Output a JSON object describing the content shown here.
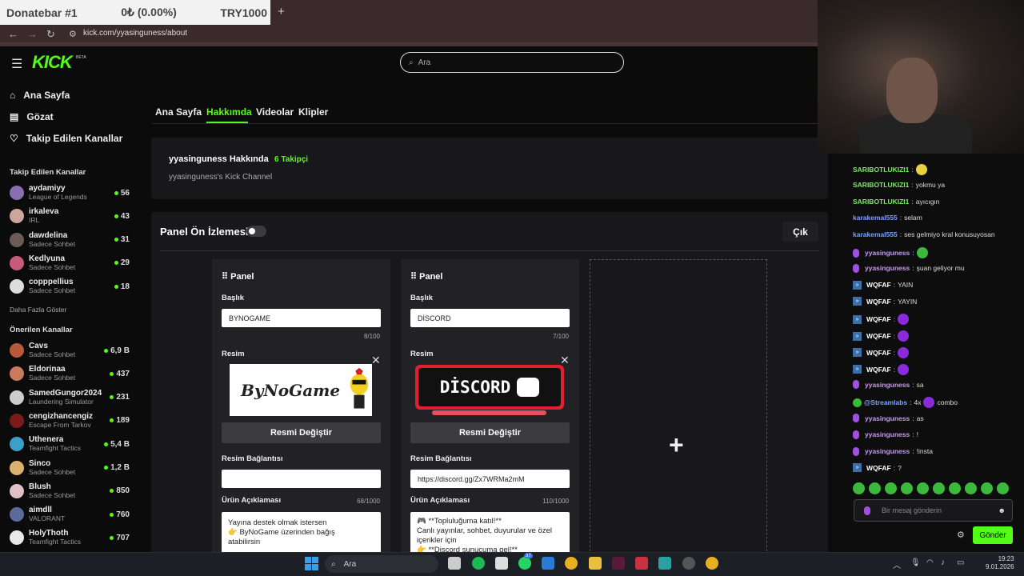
{
  "overlay": {
    "title": "Donatebar #1",
    "amount": "0₺ (0.00%)",
    "goal": "TRY1000"
  },
  "browser": {
    "new_tab": "+",
    "url": "kick.com/yyasinguness/about"
  },
  "header": {
    "logo": "KICK",
    "beta": "BETA",
    "search_placeholder": "Ara"
  },
  "sidebar": {
    "nav": [
      {
        "label": "Ana Sayfa",
        "icon": "home-icon"
      },
      {
        "label": "Gözat",
        "icon": "browse-icon"
      },
      {
        "label": "Takip Edilen Kanallar",
        "icon": "heart-icon"
      }
    ],
    "followed_title": "Takip Edilen Kanallar",
    "followed": [
      {
        "name": "aydamiyy",
        "game": "League of Legends",
        "viewers": "56",
        "color": "#8a6fb0"
      },
      {
        "name": "irkaleva",
        "game": "IRL",
        "viewers": "43",
        "color": "#c9a89a"
      },
      {
        "name": "dawdelina",
        "game": "Sadece Sohbet",
        "viewers": "31",
        "color": "#6b5a55"
      },
      {
        "name": "Kedlyuna",
        "game": "Sadece Sohbet",
        "viewers": "29",
        "color": "#c85a7a"
      },
      {
        "name": "copppellius",
        "game": "Sadece Sohbet",
        "viewers": "18",
        "color": "#dddddd"
      }
    ],
    "show_more": "Daha Fazla Göster",
    "recommended_title": "Önerilen Kanallar",
    "recommended": [
      {
        "name": "Cavs",
        "game": "Sadece Sohbet",
        "viewers": "6,9 B",
        "color": "#b85a3a"
      },
      {
        "name": "Eldorinaa",
        "game": "Sadece Sohbet",
        "viewers": "437",
        "color": "#c97a5a"
      },
      {
        "name": "SamedGungor2024",
        "game": "Laundering Simulator",
        "viewers": "231",
        "color": "#cccccc"
      },
      {
        "name": "cengizhancengiz",
        "game": "Escape From Tarkov",
        "viewers": "189",
        "color": "#7a1a1a"
      },
      {
        "name": "Uthenera",
        "game": "Teamfight Tactics",
        "viewers": "5,4 B",
        "color": "#3aa0c8"
      },
      {
        "name": "Sinco",
        "game": "Sadece Sohbet",
        "viewers": "1,2 B",
        "color": "#d8b070"
      },
      {
        "name": "Blush",
        "game": "Sadece Sohbet",
        "viewers": "850",
        "color": "#e0c0c8"
      },
      {
        "name": "aimdll",
        "game": "VALORANT",
        "viewers": "760",
        "color": "#5a6a9a"
      },
      {
        "name": "HolyThoth",
        "game": "Teamfight Tactics",
        "viewers": "707",
        "color": "#e8e8e8"
      }
    ]
  },
  "tabs": [
    "Ana Sayfa",
    "Hakkımda",
    "Videolar",
    "Klipler"
  ],
  "about": {
    "title": "yyasinguness Hakkında",
    "followers": "6 Takipçi",
    "description": "yyasinguness's Kick Channel"
  },
  "preview": {
    "title": "Panel Ön İzlemesi",
    "exit": "Çık"
  },
  "panels": [
    {
      "header": "Panel",
      "title_label": "Başlık",
      "title_value": "BYNOGAME",
      "title_count": "8/100",
      "image_label": "Resim",
      "image_text": "ByNoGame",
      "change_image": "Resmi Değiştir",
      "link_label": "Resim Bağlantısı",
      "link_value": "",
      "desc_label": "Ürün Açıklaması",
      "desc_count": "68/1000",
      "desc_value": "Yayına destek olmak istersen\n👉 ByNoGame üzerinden bağış\natabilirsin"
    },
    {
      "header": "Panel",
      "title_label": "Başlık",
      "title_value": "DİSCORD",
      "title_count": "7/100",
      "image_label": "Resim",
      "image_text": "DİSCORD",
      "change_image": "Resmi Değiştir",
      "link_label": "Resim Bağlantısı",
      "link_value": "https://discord.gg/Zx7WRMa2mM",
      "desc_label": "Ürün Açıklaması",
      "desc_count": "110/1000",
      "desc_value": "🎮 **Topluluğuma katıl!**\nCanlı yayınlar, sohbet, duyurular ve özel\niçerikler için\n👉 **Discord sunucuma gel!**"
    }
  ],
  "chat": {
    "messages": [
      {
        "user": "SARIBOTLUKIZI1",
        "text": "",
        "emote": true,
        "color": "#7ee86c",
        "badge": "none"
      },
      {
        "user": "SARIBOTLUKIZI1",
        "text": "yokmu ya",
        "emote": false,
        "color": "#7ee86c",
        "badge": "none"
      },
      {
        "user": "SARIBOTLUKIZI1",
        "text": "ayıcıgın",
        "emote": false,
        "color": "#7ee86c",
        "badge": "none"
      },
      {
        "user": "karakemal555",
        "text": "selam",
        "emote": false,
        "color": "#7aa0ff",
        "badge": "none"
      },
      {
        "user": "karakemal555",
        "text": "ses gelmiyo kral konusuyosan",
        "emote": false,
        "color": "#7aa0ff",
        "badge": "none"
      },
      {
        "user": "yyasinguness",
        "text": "",
        "emote": true,
        "color": "#c89af0",
        "badge": "mic"
      },
      {
        "user": "yyasinguness",
        "text": "şuan geliyor mu",
        "emote": false,
        "color": "#c89af0",
        "badge": "mic"
      },
      {
        "user": "WQFAF",
        "text": "YAIN",
        "emote": false,
        "color": "#ffffff",
        "badge": "kick"
      },
      {
        "user": "WQFAF",
        "text": "YAYIN",
        "emote": false,
        "color": "#ffffff",
        "badge": "kick"
      },
      {
        "user": "WQFAF",
        "text": "",
        "emote": true,
        "color": "#ffffff",
        "badge": "kick"
      },
      {
        "user": "WQFAF",
        "text": "",
        "emote": true,
        "color": "#ffffff",
        "badge": "kick"
      },
      {
        "user": "WQFAF",
        "text": "",
        "emote": true,
        "color": "#ffffff",
        "badge": "kick"
      },
      {
        "user": "WQFAF",
        "text": "",
        "emote": true,
        "color": "#ffffff",
        "badge": "kick"
      },
      {
        "user": "yyasinguness",
        "text": "sa",
        "emote": false,
        "color": "#c89af0",
        "badge": "mic"
      },
      {
        "user": "@Streamlabs",
        "text": "4x",
        "emote": true,
        "after": "combo",
        "color": "#7aa0ff",
        "badge": "check"
      },
      {
        "user": "yyasinguness",
        "text": "as",
        "emote": false,
        "color": "#c89af0",
        "badge": "mic"
      },
      {
        "user": "yyasinguness",
        "text": "!",
        "emote": false,
        "color": "#c89af0",
        "badge": "mic"
      },
      {
        "user": "yyasinguness",
        "text": "!insta",
        "emote": false,
        "color": "#c89af0",
        "badge": "mic"
      },
      {
        "user": "WQFAF",
        "text": "?",
        "emote": false,
        "color": "#ffffff",
        "badge": "kick"
      }
    ],
    "input_placeholder": "Bir mesaj gönderin",
    "send": "Gönder"
  },
  "taskbar": {
    "search": "Ara",
    "time": "19:23",
    "date": "9.01.2026",
    "badge": "37"
  }
}
